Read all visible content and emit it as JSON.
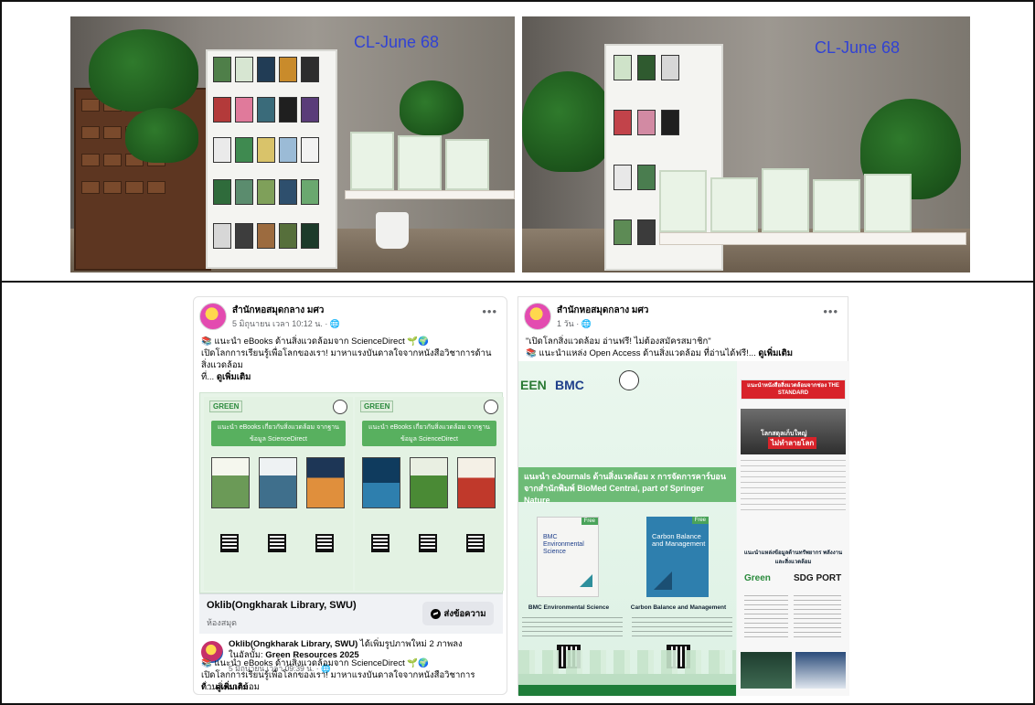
{
  "photos": {
    "left_label": "CL-June 68",
    "right_label": "CL-June 68"
  },
  "post_left": {
    "page_name": "สำนักหอสมุดกลาง มศว",
    "meta": "5 มิถุนายน เวลา 10:12 น. · ",
    "more_icon": "more-horizontal-icon",
    "text_line1": "📚 แนะนำ eBooks ด้านสิ่งแวดล้อมจาก ScienceDirect 🌱🌍",
    "text_line2": "เปิดโลกการเรียนรู้เพื่อโลกของเรา! มาหาแรงบันดาลใจจากหนังสือวิชาการด้าน",
    "text_line3": "สิ่งแวดล้อม",
    "text_line4": "ที่... ",
    "see_more": "ดูเพิ่มเติม",
    "preview": {
      "left_brand": "GREEN",
      "left_banner": "แนะนำ eBooks เกี่ยวกับสิ่งแวดล้อม จากฐานข้อมูล ScienceDirect",
      "right_brand": "GREEN",
      "right_banner": "แนะนำ eBooks เกี่ยวกับสิ่งแวดล้อม จากฐานข้อมูล ScienceDirect",
      "title": "Oklib(Ongkharak Library, SWU)",
      "subtitle": "ห้องสมุด",
      "message_button": "ส่งข้อความ"
    },
    "share": {
      "name": "Oklib(Ongkharak Library, SWU)",
      "action": " ได้เพิ่มรูปภาพใหม่ 2 ภาพลง",
      "album_prefix": "ในอัลบั้ม: ",
      "album": "Green Resources 2025",
      "meta": "5 มิถุนายน เวลา 09:39 น. · ",
      "text_line1": "📚 แนะนำ eBooks ด้านสิ่งแวดล้อมจาก ScienceDirect 🌱🌍",
      "text_line2": "เปิดโลกการเรียนรู้เพื่อโลกของเรา! มาหาแรงบันดาลใจจากหนังสือวิชาการ",
      "text_line3": "ด้านสิ่งแวดล้อม",
      "text_line4": "ที่... ",
      "see_more": "ดูเพิ่มเติม"
    }
  },
  "post_right": {
    "page_name": "สำนักหอสมุดกลาง มศว",
    "meta": "1 วัน · ",
    "more_icon": "more-horizontal-icon",
    "text_line1": "\"เปิดโลกสิ่งแวดล้อม อ่านฟรี! ไม่ต้องสมัครสมาชิก\"",
    "text_line2": "📚 แนะนำแหล่ง Open Access ด้านสิ่งแวดล้อม ที่อ่านได้ฟรี!... ",
    "see_more": "ดูเพิ่มเติม",
    "image": {
      "brand_green": "EEN",
      "brand_bmc": "BMC",
      "band": "แนะนำ eJournals ด้านสิ่งแวดล้อม x การจัดการคาร์บอน จากสำนักพิมพ์ BioMed Central, part of Springer Nature",
      "book1_title": "BMC Environmental Science",
      "book1_badge": "Free",
      "book2_title": "Carbon Balance and Management",
      "book2_badge": "Free",
      "caption1": "BMC Environmental Science",
      "caption2": "Carbon Balance and Management",
      "side_header": "แนะนำหนังสือสิ่งแวดล้อมจากช่อง THE STANDARD",
      "video_line1": "โลกสดุลเก็บใหญ่",
      "video_line2": "ไม่ทำลายโลก",
      "side_header2": "แนะนำแหล่งข้อมูลด้านทรัพยากร พลังงาน และสิ่งแวดล้อม",
      "green_logo": "Green",
      "sdg_logo": "SDG PORT"
    }
  }
}
